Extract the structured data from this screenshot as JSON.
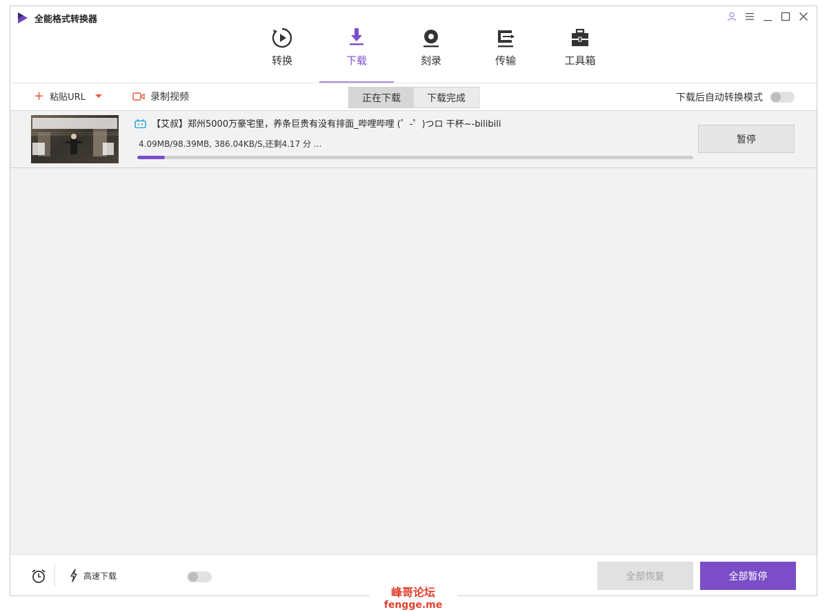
{
  "app": {
    "title": "全能格式转换器"
  },
  "nav": [
    {
      "label": "转换",
      "icon": "convert-icon"
    },
    {
      "label": "下载",
      "icon": "download-icon",
      "active": true
    },
    {
      "label": "刻录",
      "icon": "burn-disc-icon"
    },
    {
      "label": "传输",
      "icon": "transfer-icon"
    },
    {
      "label": "工具箱",
      "icon": "toolbox-icon"
    }
  ],
  "toolbar": {
    "paste_url_label": "粘贴URL",
    "record_video_label": "录制视频",
    "tabs": [
      "正在下载",
      "下载完成"
    ],
    "active_tab": "正在下载",
    "auto_convert_label": "下载后自动转换模式",
    "auto_convert_on": false
  },
  "downloads": [
    {
      "title": "【艾叔】郑州5000万豪宅里，养条巨贵有没有排面_哔哩哔哩 (゜-゜)つロ 干杯~-bilibili",
      "source_icon": "bilibili-icon",
      "stats": "4.09MB/98.39MB, 386.04KB/S,还剩4.17 分 ...",
      "progress": 0.05,
      "action_label": "暂停"
    }
  ],
  "footer": {
    "high_speed_label": "高速下载",
    "high_speed_on": false,
    "resume_all_label": "全部恢复",
    "pause_all_label": "全部暂停"
  },
  "watermark": {
    "cn": "峰哥论坛",
    "en": "fengge.me"
  },
  "colors": {
    "accent": "#7b4dc6",
    "accent_light": "#a88ae0",
    "danger": "#e2573c"
  }
}
